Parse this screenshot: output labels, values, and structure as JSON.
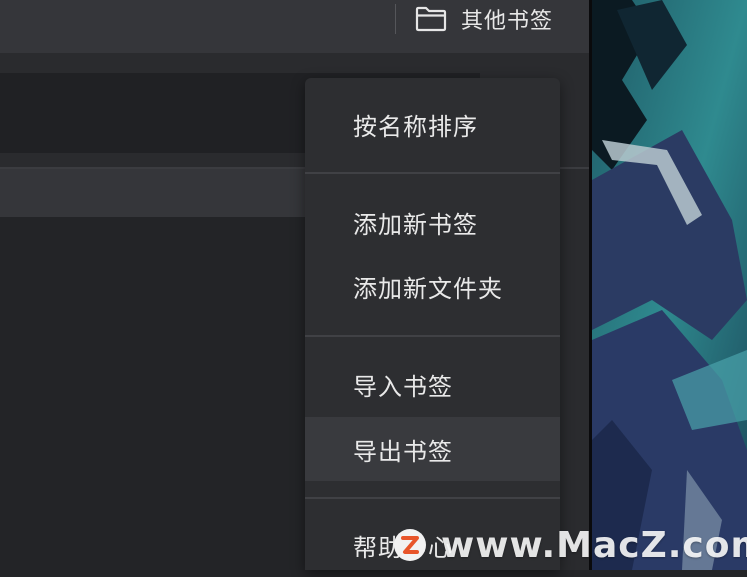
{
  "bookmarks_bar": {
    "other_bookmarks_label": "其他书签",
    "folder_icon": "folder-icon"
  },
  "context_menu": {
    "sort_by_name": "按名称排序",
    "add_bookmark": "添加新书签",
    "add_folder": "添加新文件夹",
    "import_bookmarks": "导入书签",
    "export_bookmarks": "导出书签",
    "help_center": "帮助中心"
  },
  "watermark": {
    "text": "www.MacZ.com",
    "logo_letter": "Z"
  }
}
